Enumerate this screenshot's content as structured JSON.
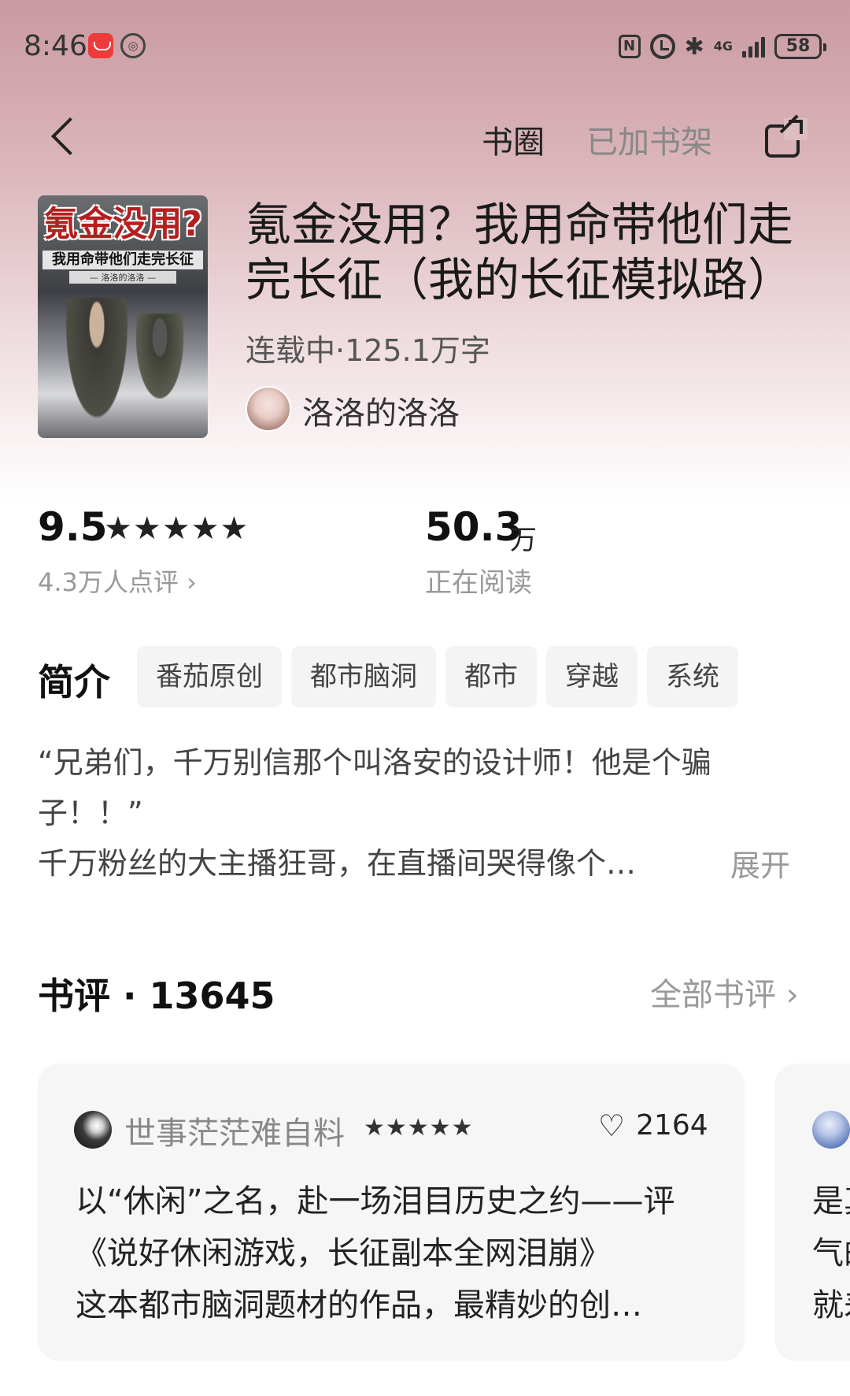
{
  "status_bar": {
    "time": "8:46",
    "battery": "58",
    "network": "4G",
    "icons": [
      "huawei-app-icon",
      "nfc-icon",
      "alarm-icon",
      "bluetooth-icon",
      "signal-icon",
      "battery-icon"
    ]
  },
  "nav": {
    "book_circle": "书圈",
    "added_to_shelf": "已加书架",
    "icons": [
      "back-icon",
      "share-icon"
    ]
  },
  "book": {
    "cover_title": "氪金没用?",
    "cover_subtitle": "我用命带他们走完长征",
    "cover_author": "— 洛洛的洛洛 —",
    "title": "氪金没用？我用命带他们走完长征（我的长征模拟路）",
    "status": "连载中·125.1万字",
    "author": "洛洛的洛洛"
  },
  "stats": {
    "rating": "9.5",
    "rating_stars": "★★★★★",
    "rating_count": "4.3万人点评 ›",
    "readers": "50.3",
    "readers_unit": "万",
    "readers_label": "正在阅读"
  },
  "intro": {
    "heading": "简介",
    "tags": [
      "番茄原创",
      "都市脑洞",
      "都市",
      "穿越",
      "系统"
    ],
    "lines": [
      "“兄弟们，千万别信那个叫洛安的设计师！他是个骗",
      "子！！”",
      "千万粉丝的大主播狂哥，在直播间哭得像个…"
    ],
    "expand": "展开"
  },
  "reviews": {
    "heading": "书评 · 13645",
    "all_reviews": "全部书评 ›",
    "items": [
      {
        "user": "世事茫茫难自料",
        "stars": "★★★★★",
        "likes": "2164",
        "lines": [
          "以“休闲”之名，赴一场泪目历史之约——评",
          "《说好休闲游戏，长征副本全网泪崩》",
          "这本都市脑洞题材的作品，最精妙的创…"
        ]
      },
      {
        "lines": [
          "是真",
          "气的",
          "就差"
        ]
      }
    ]
  },
  "colors": {
    "header_gradient_top": "#c99aa1",
    "header_gradient_bottom": "#ffffff",
    "cover_title_red": "#b51f1f",
    "muted_text": "#999999"
  }
}
